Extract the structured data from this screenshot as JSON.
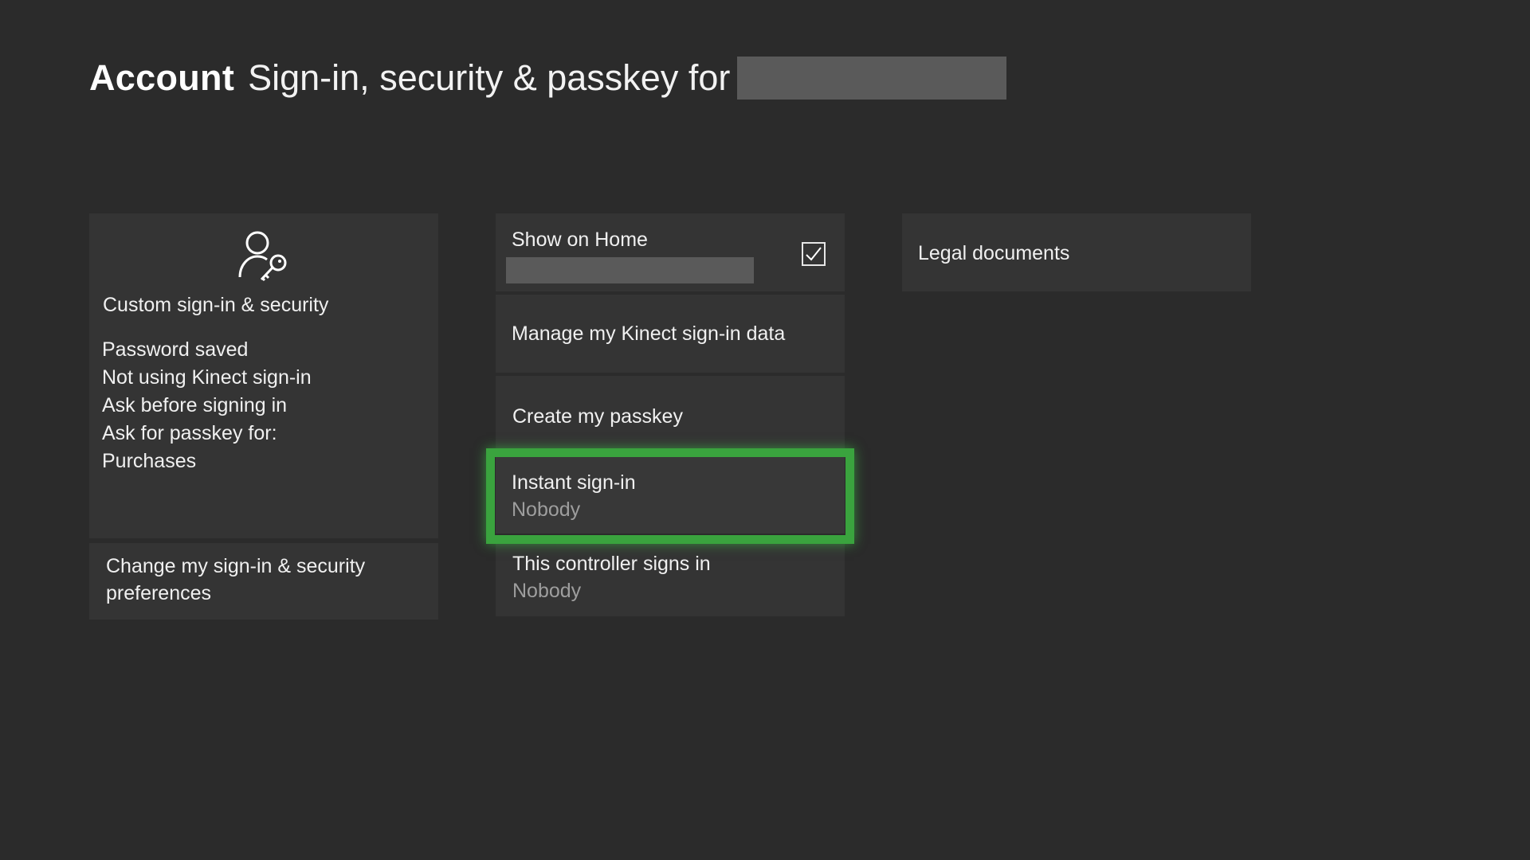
{
  "header": {
    "section": "Account",
    "subtitle": "Sign-in, security & passkey for"
  },
  "overview": {
    "icon": "user-key-icon",
    "title": "Custom sign-in & security",
    "details": [
      "Password saved",
      "Not using Kinect sign-in",
      "Ask before signing in",
      "Ask for passkey for:",
      "Purchases"
    ]
  },
  "change_prefs": {
    "label": "Change my sign-in & security preferences"
  },
  "show_on_home": {
    "label": "Show on Home",
    "checked": true
  },
  "kinect": {
    "label": "Manage my Kinect sign-in data"
  },
  "passkey": {
    "label": "Create my passkey"
  },
  "instant_signin": {
    "label": "Instant sign-in",
    "value": "Nobody"
  },
  "controller_signin": {
    "label": "This controller signs in",
    "value": "Nobody"
  },
  "legal": {
    "label": "Legal documents"
  },
  "colors": {
    "background": "#2b2b2b",
    "tile": "#343434",
    "focus": "#3aa33e",
    "secondary_text": "#9e9e9e"
  }
}
